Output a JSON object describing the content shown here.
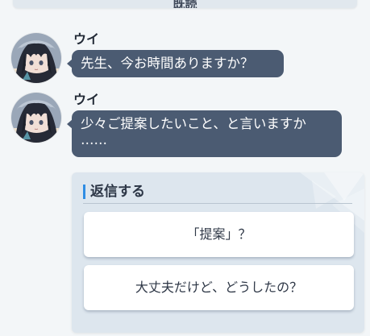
{
  "top_bar": {
    "label": "既読"
  },
  "messages": [
    {
      "sender": "ウイ",
      "text": "先生、今お時間ありますか？"
    },
    {
      "sender": "ウイ",
      "text": "少々ご提案したいこと、と言いますか\n……"
    }
  ],
  "reply": {
    "title": "返信する",
    "options": [
      "「提案」？",
      "大丈夫だけど、どうしたの？"
    ]
  },
  "colors": {
    "bubble": "#4b5b72",
    "reply_accent": "#2f8de4",
    "background": "#f3f6f8"
  }
}
